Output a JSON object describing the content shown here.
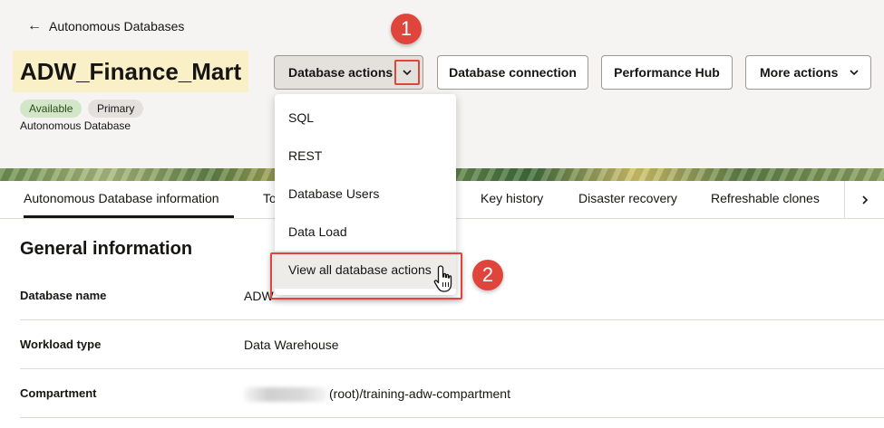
{
  "nav": {
    "back_label": "Autonomous Databases"
  },
  "title": "ADW_Finance_Mart",
  "actions": {
    "database_actions": "Database actions",
    "database_connection": "Database connection",
    "performance_hub": "Performance Hub",
    "more_actions": "More actions"
  },
  "badges": {
    "available": "Available",
    "primary": "Primary"
  },
  "subtitle": "Autonomous Database",
  "callouts": {
    "step1": "1",
    "step2": "2"
  },
  "tabs": [
    {
      "label": "Autonomous Database information",
      "selected": true
    },
    {
      "label": "To",
      "selected": false
    },
    {
      "label": "Key history",
      "selected": false
    },
    {
      "label": "Disaster recovery",
      "selected": false
    },
    {
      "label": "Refreshable clones",
      "selected": false
    }
  ],
  "general": {
    "title": "General information",
    "rows": [
      {
        "label": "Database name",
        "value": "ADW"
      },
      {
        "label": "Workload type",
        "value": "Data Warehouse"
      },
      {
        "label": "Compartment",
        "value": "(root)/training-adw-compartment"
      }
    ]
  },
  "menu": {
    "items": [
      {
        "label": "SQL"
      },
      {
        "label": "REST"
      },
      {
        "label": "Database Users"
      },
      {
        "label": "Data Load"
      },
      {
        "label": "View all database actions",
        "hovered": true
      }
    ]
  },
  "colors": {
    "highlight_red": "#e0453c",
    "title_bg": "#f9f0c8",
    "available_badge": "#d4e6c8"
  }
}
